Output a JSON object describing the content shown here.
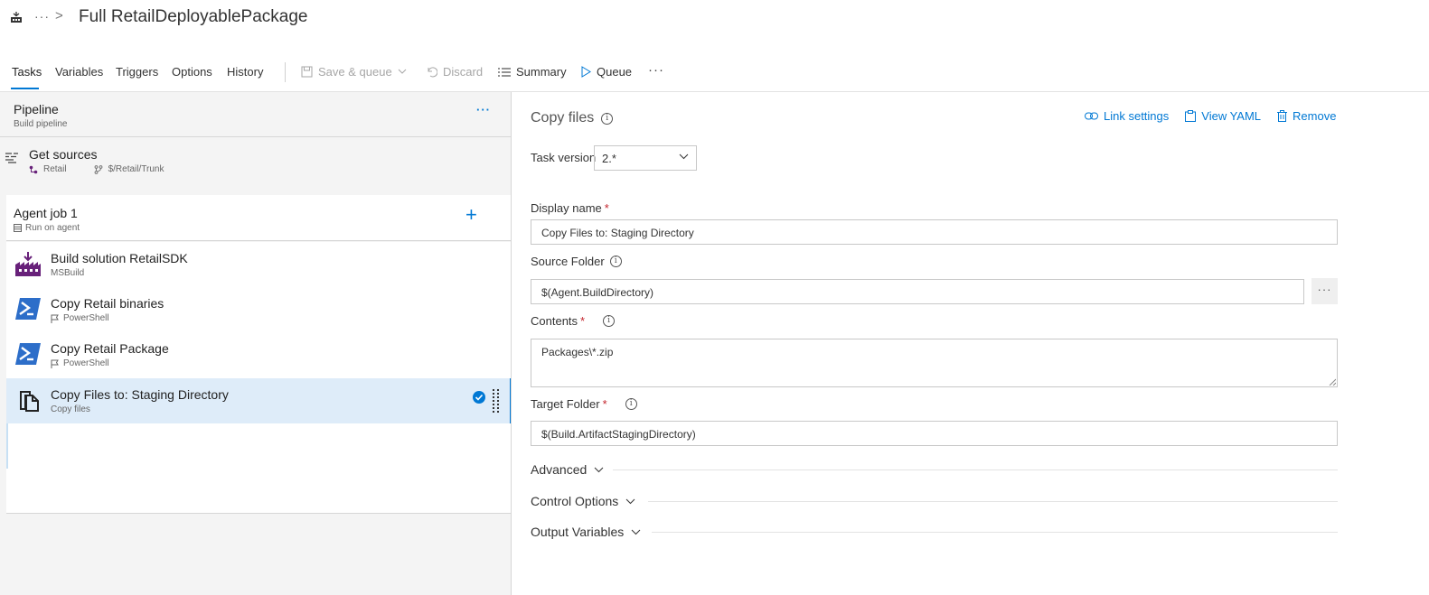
{
  "header": {
    "breadcrumb_more": "···",
    "breadcrumb_sep": ">",
    "title": "Full RetailDeployablePackage"
  },
  "tabs": [
    {
      "label": "Tasks",
      "active": true
    },
    {
      "label": "Variables"
    },
    {
      "label": "Triggers"
    },
    {
      "label": "Options"
    },
    {
      "label": "History"
    }
  ],
  "toolbar": {
    "save_queue": "Save & queue",
    "discard": "Discard",
    "summary": "Summary",
    "queue": "Queue",
    "more": "···"
  },
  "pipeline": {
    "title": "Pipeline",
    "subtitle": "Build pipeline",
    "more": "···"
  },
  "sources": {
    "title": "Get sources",
    "repo": "Retail",
    "branch": "$/Retail/Trunk"
  },
  "job": {
    "title": "Agent job 1",
    "subtitle": "Run on agent",
    "add": "+"
  },
  "tasks": [
    {
      "title": "Build solution RetailSDK",
      "subtitle": "MSBuild",
      "icon": "msbuild-icon"
    },
    {
      "title": "Copy Retail binaries",
      "subtitle": "PowerShell",
      "icon": "powershell-icon"
    },
    {
      "title": "Copy Retail Package",
      "subtitle": "PowerShell",
      "icon": "powershell-icon"
    },
    {
      "title": "Copy Files to: Staging Directory",
      "subtitle": "Copy files",
      "icon": "copy-files-icon",
      "selected": true
    }
  ],
  "details": {
    "title": "Copy files",
    "links": {
      "link_settings": "Link settings",
      "view_yaml": "View YAML",
      "remove": "Remove"
    },
    "task_version_label": "Task version",
    "task_version_value": "2.*",
    "display_name_label": "Display name",
    "display_name_value": "Copy Files to: Staging Directory",
    "source_folder_label": "Source Folder",
    "source_folder_value": "$(Agent.BuildDirectory)",
    "browse": "···",
    "contents_label": "Contents",
    "contents_value": "Packages\\*.zip",
    "target_folder_label": "Target Folder",
    "target_folder_value": "$(Build.ArtifactStagingDirectory)",
    "required_mark": "*",
    "sections": [
      "Advanced",
      "Control Options",
      "Output Variables"
    ]
  },
  "colors": {
    "accent": "#0078d4",
    "selected_bg": "#deecf9",
    "required": "#c4262e",
    "msbuild_purple": "#68217a",
    "powershell_blue": "#2d6ec9"
  }
}
